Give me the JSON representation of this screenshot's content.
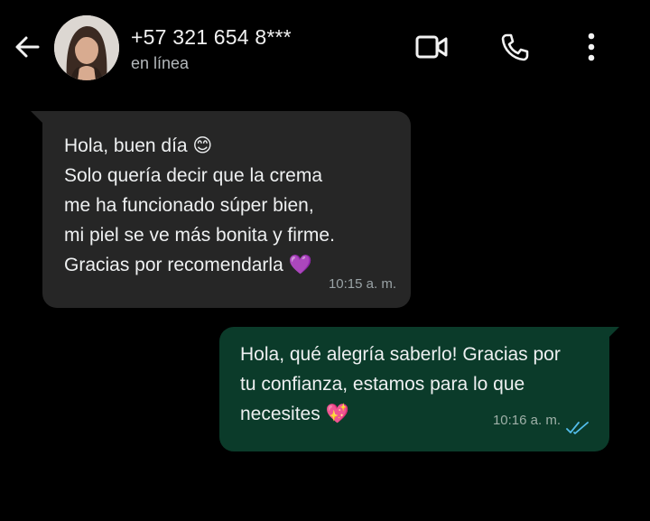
{
  "header": {
    "contact_name": "+57 321 654 8***",
    "status": "en línea"
  },
  "messages": {
    "incoming": {
      "lines": [
        "Hola, buen día 😊",
        "Solo quería decir que la crema",
        "me ha funcionado súper bien,",
        "mi piel se ve más bonita y firme.",
        "Gracias por recomendarla 💜"
      ],
      "time": "10:15 a. m."
    },
    "outgoing": {
      "lines": [
        "Hola, qué alegría saberlo! Gracias por",
        "tu confianza, estamos para lo que",
        "necesites 💖"
      ],
      "time": "10:16 a. m.",
      "read_status": "read-double-check",
      "tick_color": "#53bdeb"
    }
  },
  "colors": {
    "background": "#000000",
    "incoming_bubble": "#262626",
    "outgoing_bubble": "#0b3b2a"
  }
}
